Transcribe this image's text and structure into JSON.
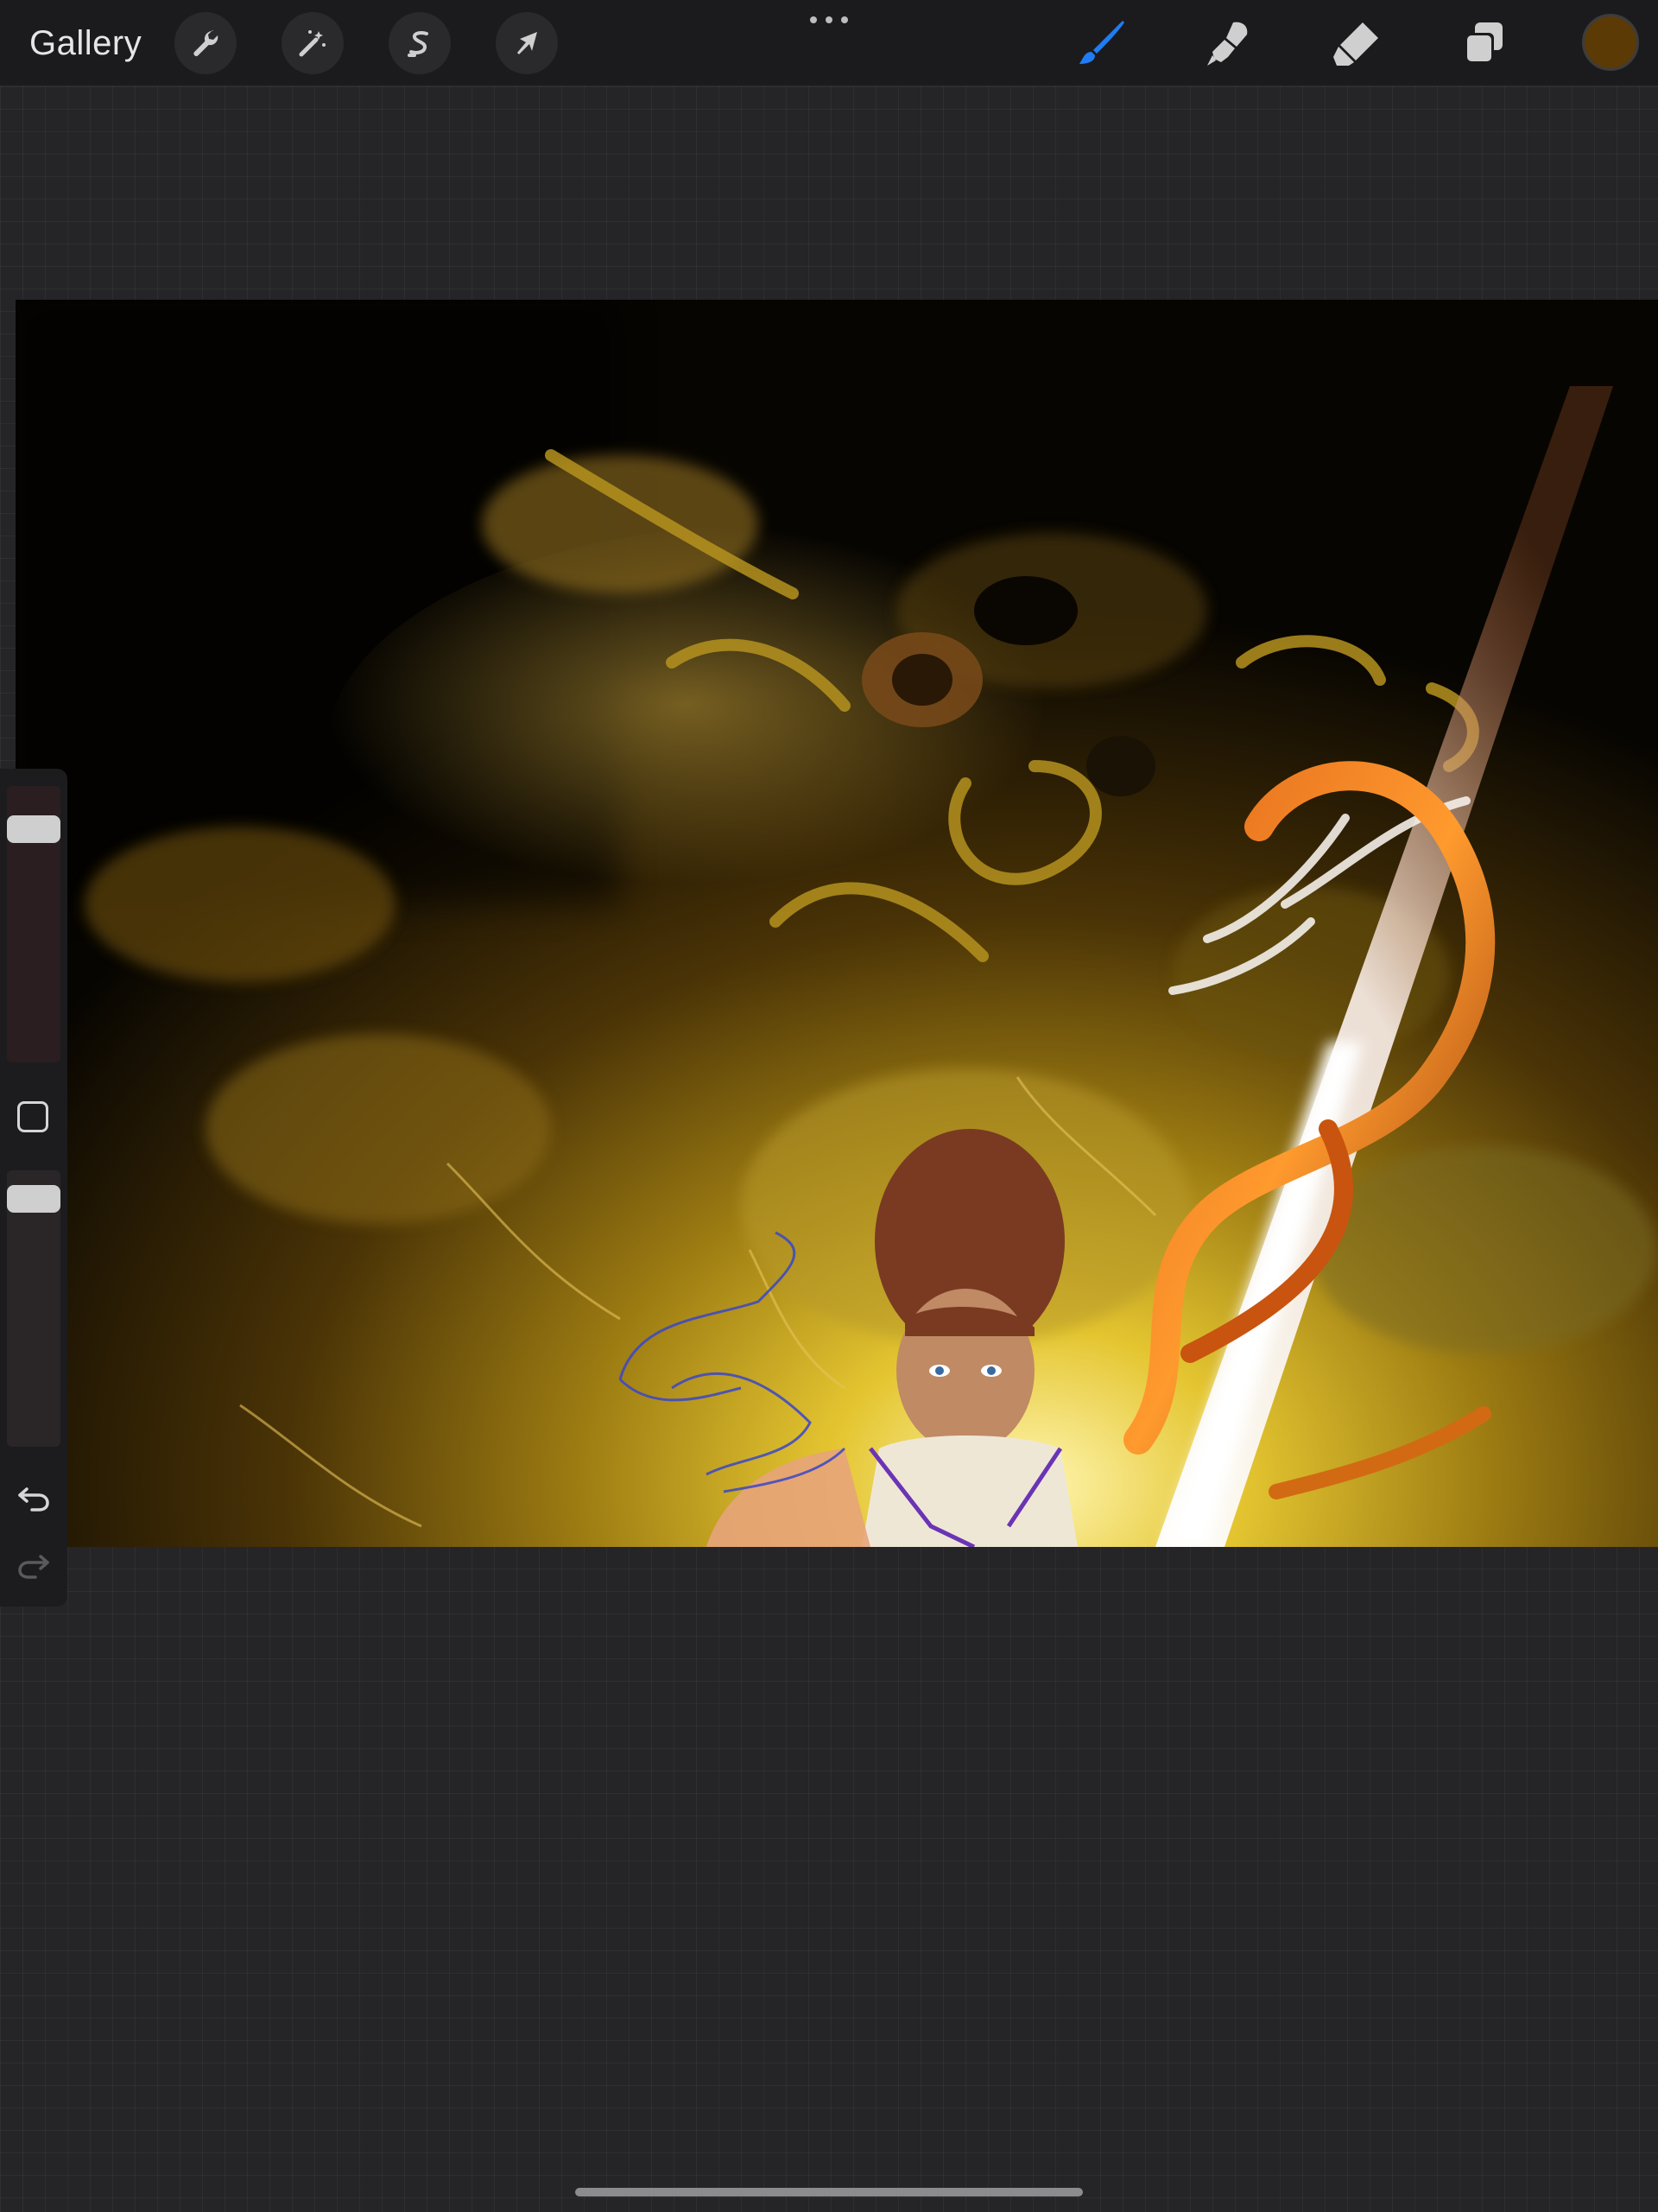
{
  "topbar": {
    "gallery_label": "Gallery",
    "left_tools": [
      {
        "name": "actions",
        "icon": "wrench-icon"
      },
      {
        "name": "adjustments",
        "icon": "magic-wand-icon"
      },
      {
        "name": "selection",
        "icon": "selection-s-icon"
      },
      {
        "name": "transform",
        "icon": "arrow-cursor-icon"
      }
    ],
    "more_icon": "more-dots-icon",
    "right_tools": [
      {
        "name": "brush",
        "icon": "brush-icon",
        "active": true
      },
      {
        "name": "smudge",
        "icon": "smudge-icon",
        "active": false
      },
      {
        "name": "eraser",
        "icon": "eraser-icon",
        "active": false
      },
      {
        "name": "layers",
        "icon": "layers-icon",
        "active": false
      }
    ],
    "current_color": "#5c3a06",
    "active_tool_color": "#1f7cf2"
  },
  "sidebar": {
    "brush_size_icon": "brush-size-slider",
    "modify_icon": "modify-square-icon",
    "opacity_icon": "opacity-slider",
    "undo_icon": "undo-arrow-icon",
    "redo_icon": "redo-arrow-icon"
  },
  "canvas": {
    "artwork": "digital-painting"
  }
}
